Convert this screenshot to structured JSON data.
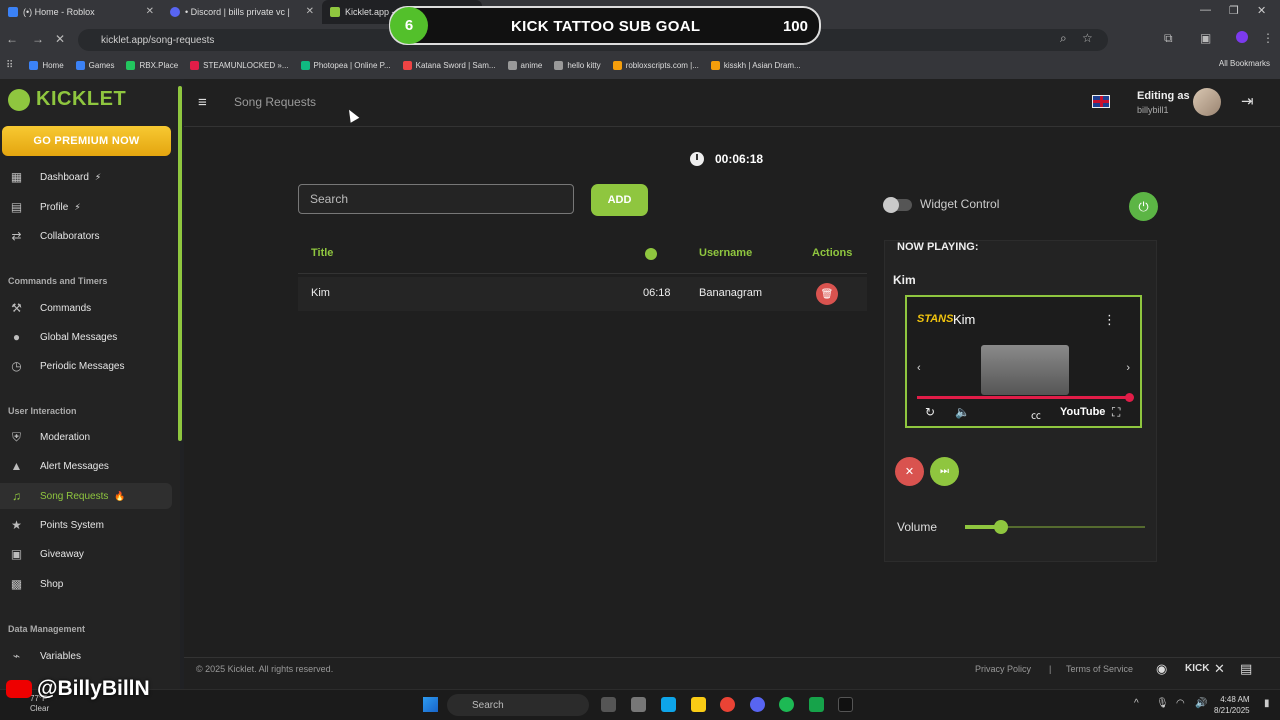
{
  "browser": {
    "tabs": [
      {
        "label": "(•) Home - Roblox",
        "color": "#3b82f6"
      },
      {
        "label": "• Discord | bills private vc |",
        "color": "#5865f2"
      },
      {
        "label": "Kicklet.app - K",
        "color": "#8fc63f"
      }
    ],
    "url": "kicklet.app/song-requests",
    "bookmarks": [
      {
        "label": "Home",
        "color": "#3b82f6"
      },
      {
        "label": "Games",
        "color": "#3b82f6"
      },
      {
        "label": "RBX.Place",
        "color": "#22c55e"
      },
      {
        "label": "STEAMUNLOCKED »...",
        "color": "#e11d48"
      },
      {
        "label": "Photopea | Online P...",
        "color": "#10b981"
      },
      {
        "label": "Katana Sword | Sam...",
        "color": "#ef4444"
      },
      {
        "label": "anime",
        "color": "#999999"
      },
      {
        "label": "hello kitty",
        "color": "#999999"
      },
      {
        "label": "robloxscripts.com |...",
        "color": "#f59e0b"
      },
      {
        "label": "kisskh | Asian Dram...",
        "color": "#f59e0b"
      }
    ],
    "all_bookmarks": "All Bookmarks"
  },
  "goal_overlay": {
    "count": "6",
    "title": "KICK TATTOO SUB GOAL",
    "target": "100"
  },
  "sidebar": {
    "logo_text": "KICKLET",
    "premium_label": "GO PREMIUM NOW",
    "items": [
      {
        "label": "Dashboard",
        "icon": "▦",
        "badge": "⚡"
      },
      {
        "label": "Profile",
        "icon": "▤",
        "badge": "⚡"
      },
      {
        "label": "Collaborators",
        "icon": "⇄",
        "badge": ""
      }
    ],
    "section_commands": "Commands and Timers",
    "commands_items": [
      {
        "label": "Commands",
        "icon": "⚒",
        "badge": ""
      },
      {
        "label": "Global Messages",
        "icon": "●",
        "badge": ""
      },
      {
        "label": "Periodic Messages",
        "icon": "◷",
        "badge": ""
      }
    ],
    "section_user": "User Interaction",
    "user_items": [
      {
        "label": "Moderation",
        "icon": "⛨",
        "badge": ""
      },
      {
        "label": "Alert Messages",
        "icon": "▲",
        "badge": ""
      },
      {
        "label": "Song Requests",
        "icon": "♫",
        "badge": "🔥"
      },
      {
        "label": "Points System",
        "icon": "★",
        "badge": ""
      },
      {
        "label": "Giveaway",
        "icon": "▣",
        "badge": ""
      },
      {
        "label": "Shop",
        "icon": "▩",
        "badge": ""
      }
    ],
    "section_data": "Data Management",
    "data_items": [
      {
        "label": "Variables",
        "icon": "⌁",
        "badge": ""
      }
    ]
  },
  "topbar": {
    "page_title": "Song Requests",
    "editing_as": "Editing as",
    "username": "billybill1"
  },
  "main": {
    "timer": "00:06:18",
    "search_placeholder": "Search",
    "add_label": "ADD",
    "columns": {
      "title": "Title",
      "username": "Username",
      "actions": "Actions"
    },
    "rows": [
      {
        "title": "Kim",
        "duration": "06:18",
        "username": "Bananagram"
      }
    ]
  },
  "widget": {
    "control_label": "Widget Control",
    "now_playing_label": "NOW PLAYING:",
    "now_playing_title": "Kim",
    "player_channel": "STANS",
    "player_title": "Kim",
    "youtube_label": "YouTube",
    "volume_label": "Volume",
    "volume_fraction": 0.2
  },
  "footer": {
    "copyright": "© 2025 Kicklet. All rights reserved.",
    "privacy": "Privacy Policy",
    "separator": "|",
    "terms": "Terms of Service"
  },
  "watermark": "@BillyBillN",
  "taskbar": {
    "weather_temp": "77°F",
    "weather_text": "Clear",
    "search": "Search",
    "time": "4:48 AM",
    "date": "8/21/2025"
  },
  "colors": {
    "accent": "#8fc63f",
    "danger": "#d9534f",
    "premium": "#f0b81f"
  }
}
